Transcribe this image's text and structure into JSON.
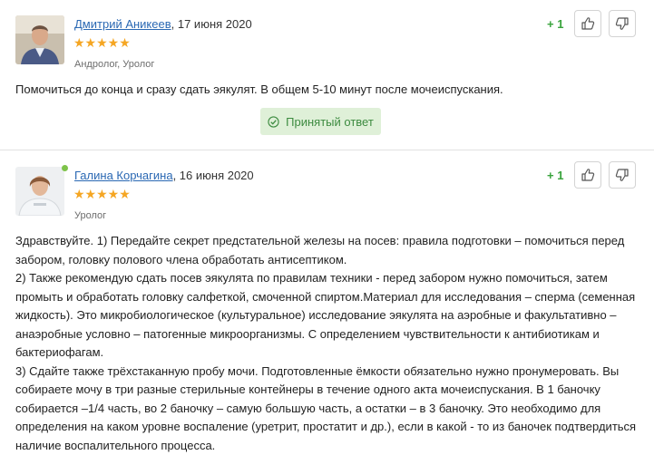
{
  "answers": [
    {
      "author": "Дмитрий Аникеев",
      "date": ", 17 июня 2020",
      "rating": "★★★★★",
      "specialty": "Андролог, Уролог",
      "score": "+ 1",
      "text": "Помочиться до конца и сразу сдать эякулят. В общем 5-10 минут после мочеиспускания.",
      "accepted_label": "Принятый ответ"
    },
    {
      "author": "Галина Корчагина",
      "date": ", 16 июня 2020",
      "rating": "★★★★★",
      "specialty": "Уролог",
      "score": "+ 1",
      "paragraphs": [
        "Здравствуйте. 1) Передайте секрет предстательной железы на посев: правила подготовки – помочиться перед забором, головку полового члена обработать антисептиком.",
        "2) Также рекомендую сдать посев эякулята по правилам техники - перед забором нужно помочиться, затем промыть и обработать головку салфеткой, смоченной спиртом.Материал для исследования – сперма (семенная жидкость). Это микробиологическое (культуральное) исследование эякулята на аэробные и факультативно – анаэробные условно – патогенные микроорганизмы. С определением чувствительности к антибиотикам и бактериофагам.",
        "3) Сдайте также трёхстаканную пробу мочи. Подготовленные ёмкости обязательно нужно пронумеровать. Вы собираете мочу в три разные стерильные контейнеры в течение одного акта мочеиспускания. В 1 баночку собирается –1/4 часть, во 2 баночку – самую большую часть, а остатки – в 3 баночку. Это необходимо для определения на каком уровне воспаление (уретрит, простатит и др.), если в какой - то из баночек подтвердиться наличие воспалительного процесса."
      ]
    }
  ],
  "colors": {
    "link": "#2a68b3",
    "star": "#f5a623",
    "score": "#39a33c",
    "accepted_bg": "#dff0d8",
    "online": "#7ec34a"
  },
  "icons": [
    "like-icon",
    "dislike-icon",
    "check-circle-icon",
    "online-status-icon"
  ]
}
